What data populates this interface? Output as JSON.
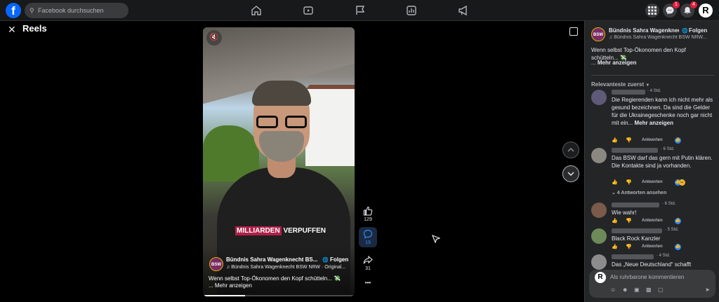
{
  "topbar": {
    "logo": "f",
    "search_placeholder": "Facebook durchsuchen",
    "nav_icons": [
      "home-icon",
      "video-icon",
      "flag-icon",
      "gaming-icon",
      "megaphone-icon"
    ],
    "messenger_badge": "1",
    "notifications_badge": "4",
    "profile_initial": "R"
  },
  "reels": {
    "close_glyph": "✕",
    "title": "Reels"
  },
  "video": {
    "caption_highlight": "MILLIARDEN",
    "caption_rest": " VERPUFFEN",
    "page_name": "Bündnis Sahra Wagenknecht BS...",
    "follow": "Folgen",
    "audio": "♫ Bündnis Sahra Wagenknecht BSW NRW · Original...",
    "description": "Wenn selbst Top-Ökonomen den Kopf schütteln... 💸",
    "more": "... Mehr anzeigen",
    "logo_text": "BSW",
    "progress": 0.28
  },
  "actions": {
    "likes": "129",
    "comments": "19",
    "shares": "31",
    "more_glyph": "•••"
  },
  "sidebar": {
    "page_name": "Bündnis Sahra Wagenknec...",
    "follow": "Folgen",
    "audio": "♫ Bündnis Sahra Wagenknecht BSW NRW...",
    "description": "Wenn selbst Top-Ökonomen den Kopf schütteln... 💸",
    "more_prefix": "... ",
    "more": "Mehr anzeigen",
    "sort_label": "Relevanteste zuerst",
    "comments": [
      {
        "time": "· 4 Std.",
        "text": "Die Regierenden kann ich nicht mehr als gesund bezeichnen. Da sind die Gelder für die Ukrainegeschenke noch gar nicht mit ein... ",
        "more": "Mehr anzeigen",
        "reply": "Antworten"
      },
      {
        "time": "· 6 Std.",
        "text": "Das BSW darf das gern mit Putin klären. Die Kontakte sind ja vorhanden.",
        "more": "",
        "reply": "Antworten"
      },
      {
        "time": "· 6 Std.",
        "text": "Wie wahr!",
        "more": "",
        "reply": "Antworten"
      },
      {
        "time": "· 5 Std.",
        "text": "Black Rock Kanzler",
        "more": "",
        "reply": "Antworten"
      },
      {
        "time": "· 4 Std.",
        "text": "Das „Neue Deutschland“ schafft",
        "more": "",
        "reply": ""
      }
    ],
    "replies_link": "⌄ 4 Antworten ansehen",
    "composer_placeholder": "Als ruhrbarone kommentieren",
    "composer_avatar": "R"
  },
  "colors": {
    "brand": "#0866ff",
    "badge": "#e41e3f",
    "accent": "#2d88ff",
    "panel": "#242526",
    "topbar": "#18191a"
  }
}
